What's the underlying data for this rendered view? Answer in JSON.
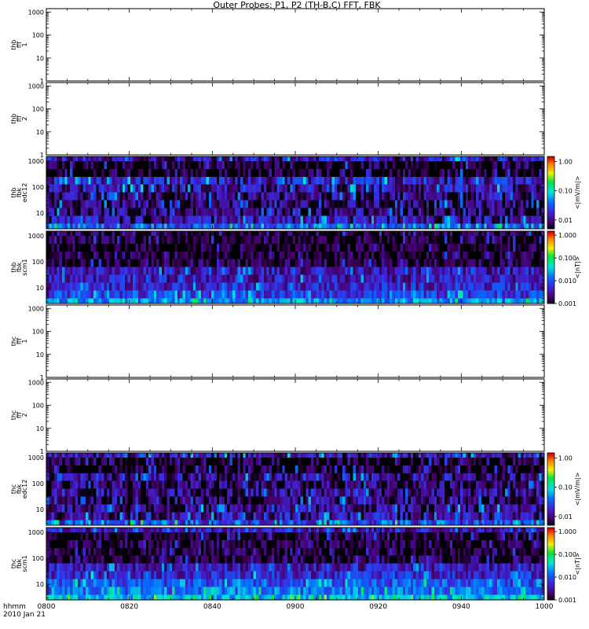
{
  "title": "Outer Probes: P1, P2 (TH-B,C) FFT, FBK",
  "footer": {
    "time_label": "hhmm",
    "date_label": "2010 Jan 21"
  },
  "x_ticks": [
    "0800",
    "0820",
    "0840",
    "0900",
    "0920",
    "0940",
    "1000"
  ],
  "colorbar_units": {
    "edc": "<|mV/m|>",
    "scm": "<|nT|>"
  },
  "chart_data": [
    {
      "type": "heatmap",
      "panel": "thb-fff-1",
      "ylabel": [
        "thb",
        "fff",
        "1"
      ],
      "yscale": "log",
      "ylim": [
        1,
        1400
      ],
      "yticks": [
        "1",
        "10",
        "100",
        "1000"
      ],
      "data": "none"
    },
    {
      "type": "heatmap",
      "panel": "thb-fff-2",
      "ylabel": [
        "thb",
        "fff",
        "2"
      ],
      "yscale": "log",
      "ylim": [
        1,
        1400
      ],
      "yticks": [
        "1",
        "10",
        "100",
        "1000"
      ],
      "data": "none"
    },
    {
      "type": "heatmap",
      "panel": "thb-fbk-edc12",
      "ylabel": [
        "thb",
        "fbk",
        "edc12"
      ],
      "yscale": "log",
      "ylim": [
        2.5,
        1500
      ],
      "yticks": [
        "10",
        "100",
        "1000"
      ],
      "colorbar": {
        "scale": "log",
        "range": [
          0.005,
          1.5
        ],
        "ticks": [
          "1.00",
          "0.10",
          "0.01"
        ],
        "units": "<|mV/m|>"
      },
      "bands_hz": [
        {
          "center": 2.9,
          "typical": 0.035
        },
        {
          "center": 5.6,
          "typical": 0.012
        },
        {
          "center": 11,
          "typical": 0.009
        },
        {
          "center": 22,
          "typical": 0.008
        },
        {
          "center": 45,
          "typical": 0.009
        },
        {
          "center": 90,
          "typical": 0.012
        },
        {
          "center": 180,
          "typical": 0.015
        },
        {
          "center": 350,
          "typical": 0.005
        },
        {
          "center": 700,
          "typical": 0.005
        },
        {
          "center": 1400,
          "typical": 0.013
        }
      ]
    },
    {
      "type": "heatmap",
      "panel": "thb-fbk-scm1",
      "ylabel": [
        "thb",
        "fbk",
        "scm1"
      ],
      "yscale": "log",
      "ylim": [
        2.5,
        1500
      ],
      "yticks": [
        "10",
        "100",
        "1000"
      ],
      "colorbar": {
        "scale": "log",
        "range": [
          0.001,
          1.5
        ],
        "ticks": [
          "1.000",
          "0.100",
          "0.010",
          "0.001"
        ],
        "units": "<|nT|>"
      },
      "bands_hz": [
        {
          "center": 2.9,
          "typical": 0.02
        },
        {
          "center": 5.6,
          "typical": 0.008
        },
        {
          "center": 11,
          "typical": 0.005
        },
        {
          "center": 22,
          "typical": 0.004
        },
        {
          "center": 45,
          "typical": 0.004
        },
        {
          "center": 90,
          "typical": 0.0015
        },
        {
          "center": 180,
          "typical": 0.0012
        },
        {
          "center": 350,
          "typical": 0.0012
        },
        {
          "center": 700,
          "typical": 0.0012
        },
        {
          "center": 1400,
          "typical": 0.0013
        }
      ]
    },
    {
      "type": "heatmap",
      "panel": "thc-fff-1",
      "ylabel": [
        "thc",
        "fff",
        "1"
      ],
      "yscale": "log",
      "ylim": [
        1,
        1400
      ],
      "yticks": [
        "1",
        "10",
        "100",
        "1000"
      ],
      "data": "none"
    },
    {
      "type": "heatmap",
      "panel": "thc-fff-2",
      "ylabel": [
        "thc",
        "fff",
        "2"
      ],
      "yscale": "log",
      "ylim": [
        1,
        1400
      ],
      "yticks": [
        "1",
        "10",
        "100",
        "1000"
      ],
      "data": "none"
    },
    {
      "type": "heatmap",
      "panel": "thc-fbk-edc12",
      "ylabel": [
        "thc",
        "fbk",
        "edc12"
      ],
      "yscale": "log",
      "ylim": [
        2.5,
        1500
      ],
      "yticks": [
        "10",
        "100",
        "1000"
      ],
      "colorbar": {
        "scale": "log",
        "range": [
          0.005,
          1.5
        ],
        "ticks": [
          "1.00",
          "0.10",
          "0.01"
        ],
        "units": "<|mV/m|>"
      },
      "bands_hz": [
        {
          "center": 2.9,
          "typical": 0.03
        },
        {
          "center": 5.6,
          "typical": 0.012
        },
        {
          "center": 11,
          "typical": 0.01
        },
        {
          "center": 22,
          "typical": 0.009
        },
        {
          "center": 45,
          "typical": 0.01
        },
        {
          "center": 90,
          "typical": 0.008
        },
        {
          "center": 180,
          "typical": 0.01
        },
        {
          "center": 350,
          "typical": 0.005
        },
        {
          "center": 700,
          "typical": 0.005
        },
        {
          "center": 1400,
          "typical": 0.013
        }
      ]
    },
    {
      "type": "heatmap",
      "panel": "thc-fbk-scm1",
      "ylabel": [
        "thc",
        "fbk",
        "scm1"
      ],
      "yscale": "log",
      "ylim": [
        2.5,
        1500
      ],
      "yticks": [
        "10",
        "100",
        "1000"
      ],
      "colorbar": {
        "scale": "log",
        "range": [
          0.001,
          1.5
        ],
        "ticks": [
          "1.000",
          "0.100",
          "0.010",
          "0.001"
        ],
        "units": "<|nT|>"
      },
      "bands_hz": [
        {
          "center": 2.9,
          "typical": 0.03
        },
        {
          "center": 5.6,
          "typical": 0.015
        },
        {
          "center": 11,
          "typical": 0.01
        },
        {
          "center": 22,
          "typical": 0.005
        },
        {
          "center": 45,
          "typical": 0.004
        },
        {
          "center": 90,
          "typical": 0.0015
        },
        {
          "center": 180,
          "typical": 0.0013
        },
        {
          "center": 350,
          "typical": 0.0013
        },
        {
          "center": 700,
          "typical": 0.0013
        },
        {
          "center": 1400,
          "typical": 0.004
        }
      ]
    }
  ]
}
